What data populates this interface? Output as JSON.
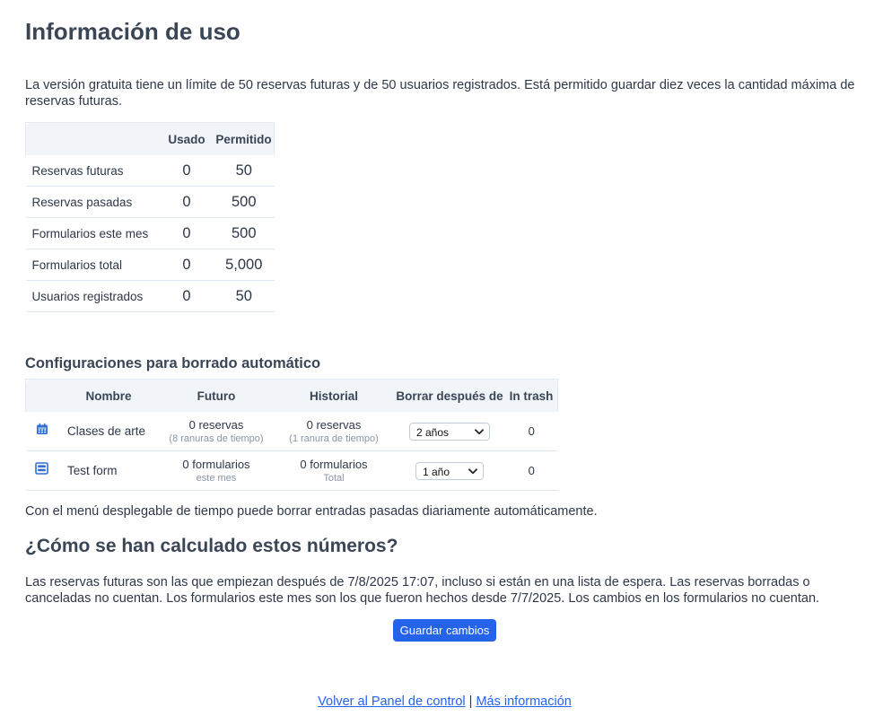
{
  "title": "Información de uso",
  "intro": "La versión gratuita tiene un límite de 50 reservas futuras y de 50 usuarios registrados. Está permitido guardar diez veces la cantidad máxima de reservas futuras.",
  "usage_table": {
    "headers": {
      "used": "Usado",
      "allowed": "Permitido"
    },
    "rows": [
      {
        "label": "Reservas futuras",
        "used": "0",
        "allowed": "50"
      },
      {
        "label": "Reservas pasadas",
        "used": "0",
        "allowed": "500"
      },
      {
        "label": "Formularios este mes",
        "used": "0",
        "allowed": "500"
      },
      {
        "label": "Formularios total",
        "used": "0",
        "allowed": "5,000"
      },
      {
        "label": "Usuarios registrados",
        "used": "0",
        "allowed": "50"
      }
    ]
  },
  "autodelete": {
    "heading": "Configuraciones para borrado automático",
    "headers": {
      "name": "Nombre",
      "future": "Futuro",
      "history": "Historial",
      "delete_after": "Borrar después de",
      "in_trash": "In trash"
    },
    "rows": [
      {
        "icon": "calendar-icon",
        "name": "Clases de arte",
        "future_main": "0 reservas",
        "future_sub": "(8 ranuras de tiempo)",
        "history_main": "0 reservas",
        "history_sub": "(1 ranura de tiempo)",
        "delete_after": "2 años",
        "in_trash": "0"
      },
      {
        "icon": "form-icon",
        "name": "Test form",
        "future_main": "0 formularios",
        "future_sub": "este mes",
        "history_main": "0 formularios",
        "history_sub": "Total",
        "delete_after": "1 año",
        "in_trash": "0"
      }
    ]
  },
  "note": "Con el menú desplegable de tiempo puede borrar entradas pasadas diariamente automáticamente.",
  "question_heading": "¿Cómo se han calculado estos números?",
  "explanation": "Las reservas futuras son las que empiezan después de 7/8/2025 17:07, incluso si están en una lista de espera. Las reservas borradas o canceladas no cuentan. Los formularios este mes son los que fueron hechos desde 7/7/2025. Los cambios en los formularios no cuentan.",
  "save_button": "Guardar cambios",
  "footer": {
    "back_link": "Volver al Panel de control",
    "separator": "|",
    "more_link": "Más información"
  },
  "colors": {
    "accent": "#2563eb",
    "header_bg": "#f1f5f9",
    "border": "#e2e8f0",
    "icon": "#2f6fd6"
  }
}
